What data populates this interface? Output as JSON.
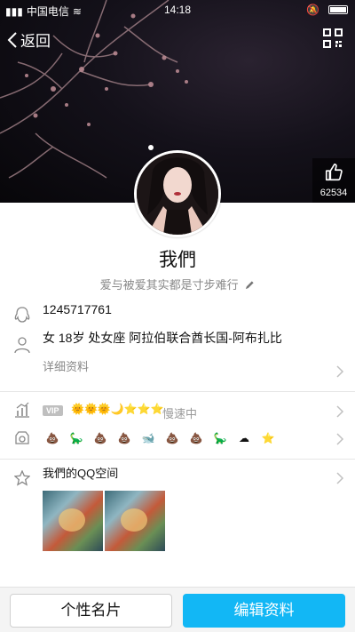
{
  "status_bar": {
    "carrier": "中国电信",
    "time": "14:18"
  },
  "nav": {
    "back_label": "返回"
  },
  "profile": {
    "likes": "62534",
    "nickname": "我們",
    "signature": "爱与被爱其实都是寸步难行",
    "qq_number": "1245717761",
    "basic_info": "女  18岁  处女座  阿拉伯联合酋长国-阿布扎比",
    "detail_link": "详细资料"
  },
  "level": {
    "vip_tag": "VIP",
    "level_icons": "🌞🌞🌞🌙⭐⭐⭐",
    "speed_text": "慢速中"
  },
  "badges": [
    "💩",
    "🦕",
    "💩",
    "💩",
    "🐋",
    "💩",
    "💩",
    "🦕",
    "☁",
    "⭐"
  ],
  "qzone": {
    "title": "我們的QQ空间",
    "photo_count": 2
  },
  "actions": {
    "card_button": "个性名片",
    "edit_button": "编辑资料"
  },
  "colors": {
    "accent": "#12b7f5",
    "cover_bg": "#0b090d"
  }
}
